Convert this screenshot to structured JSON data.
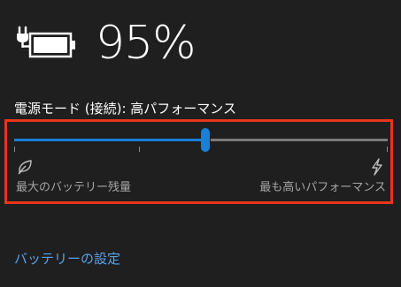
{
  "battery": {
    "percent_text": "95%",
    "icon": "battery-plugged-icon"
  },
  "power_mode": {
    "label": "電源モード (接続): 高パフォーマンス",
    "slider": {
      "positions": 4,
      "selected_index": 2,
      "level_fraction": 0.5
    },
    "left_caption": "最大のバッテリー残量",
    "right_caption": "最も高いパフォーマンス",
    "left_icon": "leaf-icon",
    "right_icon": "lightning-bolt-icon"
  },
  "links": {
    "battery_settings": "バッテリーの設定"
  },
  "colors": {
    "background": "#1f1f1f",
    "accent": "#1a7fd6",
    "track_inactive": "#7a7a7a",
    "highlight_border": "#e8361c",
    "link": "#5aa2ef",
    "caption": "#a6a6a6"
  }
}
